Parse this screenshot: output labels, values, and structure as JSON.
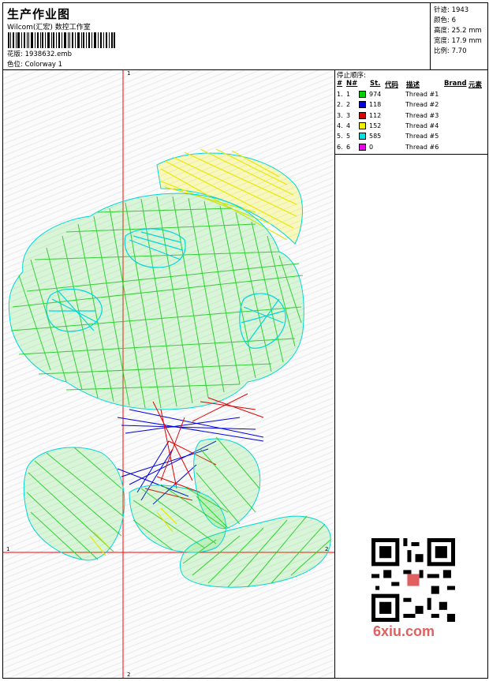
{
  "header": {
    "title": "生产作业图",
    "studio": "Wilcom(汇宏) 数控工作室",
    "file_label": "花版:",
    "file_name": "1938632.emb",
    "colorway_label": "色位:",
    "colorway": "Colorway 1"
  },
  "stats": {
    "stitches": "针迹: 1943",
    "colors": "颜色: 6",
    "height": "高度: 25.2 mm",
    "width": "宽度: 17.9 mm",
    "scale": "比例: 7.70"
  },
  "stop_sequence": {
    "title": "停止顺序:",
    "headers": {
      "hash": "#",
      "num": "N#",
      "st": "St.",
      "code": "代码",
      "desc": "描述",
      "brand": "Brand",
      "element": "元素"
    },
    "rows": [
      {
        "idx": "1.",
        "n": "1",
        "color": "#00d000",
        "st": "974",
        "desc": "Thread #1"
      },
      {
        "idx": "2.",
        "n": "2",
        "color": "#0000e0",
        "st": "118",
        "desc": "Thread #2"
      },
      {
        "idx": "3.",
        "n": "3",
        "color": "#e00000",
        "st": "112",
        "desc": "Thread #3"
      },
      {
        "idx": "4.",
        "n": "4",
        "color": "#f0f000",
        "st": "152",
        "desc": "Thread #4"
      },
      {
        "idx": "5.",
        "n": "5",
        "color": "#00e0e0",
        "st": "585",
        "desc": "Thread #5"
      },
      {
        "idx": "6.",
        "n": "6",
        "color": "#f000f0",
        "st": "0",
        "desc": "Thread #6"
      }
    ]
  },
  "axes": {
    "top": "1",
    "bottom": "2",
    "left": "1",
    "right": "2",
    "color": "#ff0000"
  },
  "watermark": {
    "site": "6xiu.com"
  }
}
